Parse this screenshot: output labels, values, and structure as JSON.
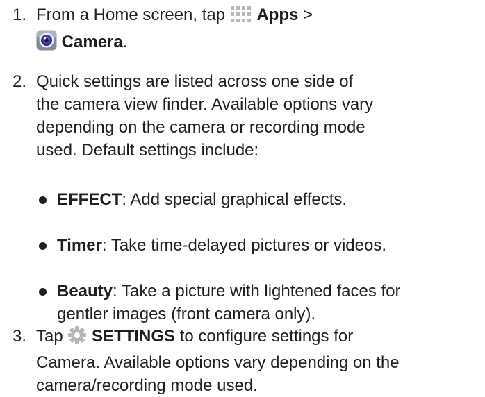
{
  "steps": [
    {
      "number": "1.",
      "line1_prefix": "From a Home screen, tap ",
      "apps_label": "Apps",
      "line1_suffix": " >",
      "camera_label": "Camera",
      "line2_suffix": "."
    },
    {
      "number": "2.",
      "lines": [
        "Quick settings are listed across one side of",
        "the camera view finder. Available options vary",
        "depending on the camera or recording mode",
        "used. Default settings include:"
      ]
    },
    {
      "number": "3.",
      "line1_prefix": "Tap ",
      "settings_label": "SETTINGS",
      "line1_suffix": " to configure settings for",
      "lines": [
        "Camera. Available options vary depending on the",
        "camera/recording mode used."
      ]
    }
  ],
  "bullets": [
    {
      "term": "EFFECT",
      "text": ": Add special graphical effects."
    },
    {
      "term": "Timer",
      "text": ": Take time-delayed pictures or videos."
    },
    {
      "term": "Beauty",
      "text": ": Take a picture with lightened faces for",
      "text2": "gentler images (front camera only)."
    }
  ],
  "icons": {
    "apps": "apps-grid-icon",
    "camera": "camera-app-icon",
    "settings": "gear-icon"
  },
  "colors": {
    "text": "#1f1f1f",
    "apps_icon": "#b8b8b8",
    "camera_icon_outer": "#8c9aa6",
    "camera_lens": "#4b3fa8",
    "gear": "#b7b7b7"
  }
}
